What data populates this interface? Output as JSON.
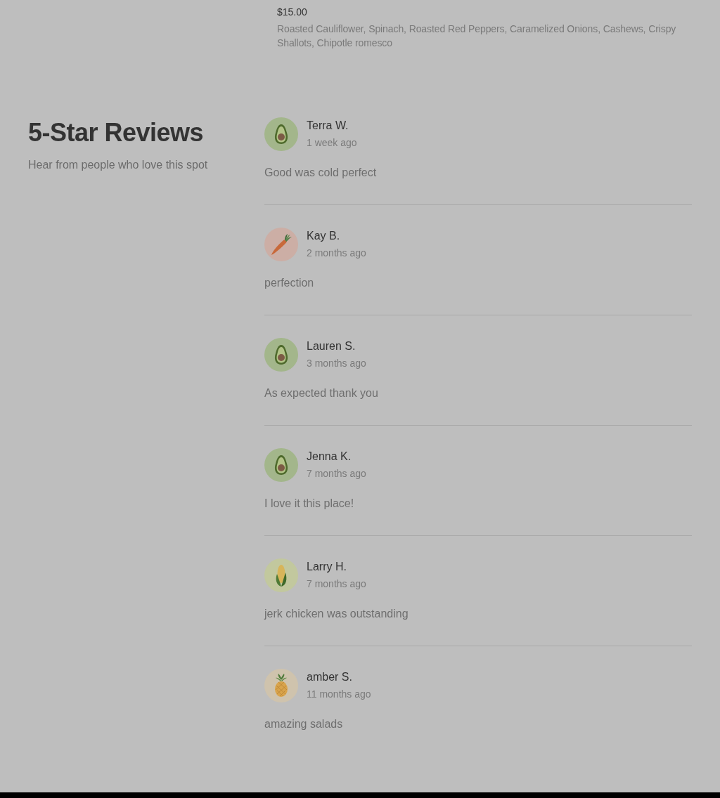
{
  "menu_item": {
    "price": "$15.00",
    "description": "Roasted Cauliflower, Spinach, Roasted Red Peppers, Caramelized Onions, Cashews, Crispy Shallots, Chipotle romesco"
  },
  "reviews_section": {
    "title": "5-Star Reviews",
    "subtitle": "Hear from people who love this spot"
  },
  "reviews": [
    {
      "name": "Terra W.",
      "time": "1 week ago",
      "text": "Good was cold perfect",
      "avatar": {
        "kind": "avocado"
      }
    },
    {
      "name": "Kay B.",
      "time": "2 months ago",
      "text": "perfection",
      "avatar": {
        "kind": "carrot"
      }
    },
    {
      "name": "Lauren S.",
      "time": "3 months ago",
      "text": "As expected thank you",
      "avatar": {
        "kind": "avocado"
      }
    },
    {
      "name": "Jenna K.",
      "time": "7 months ago",
      "text": "I love it this place!",
      "avatar": {
        "kind": "avocado"
      }
    },
    {
      "name": "Larry H.",
      "time": "7 months ago",
      "text": "jerk chicken was outstanding",
      "avatar": {
        "kind": "corn"
      }
    },
    {
      "name": "amber S.",
      "time": "11 months ago",
      "text": "amazing salads",
      "avatar": {
        "kind": "pineapple"
      }
    }
  ]
}
